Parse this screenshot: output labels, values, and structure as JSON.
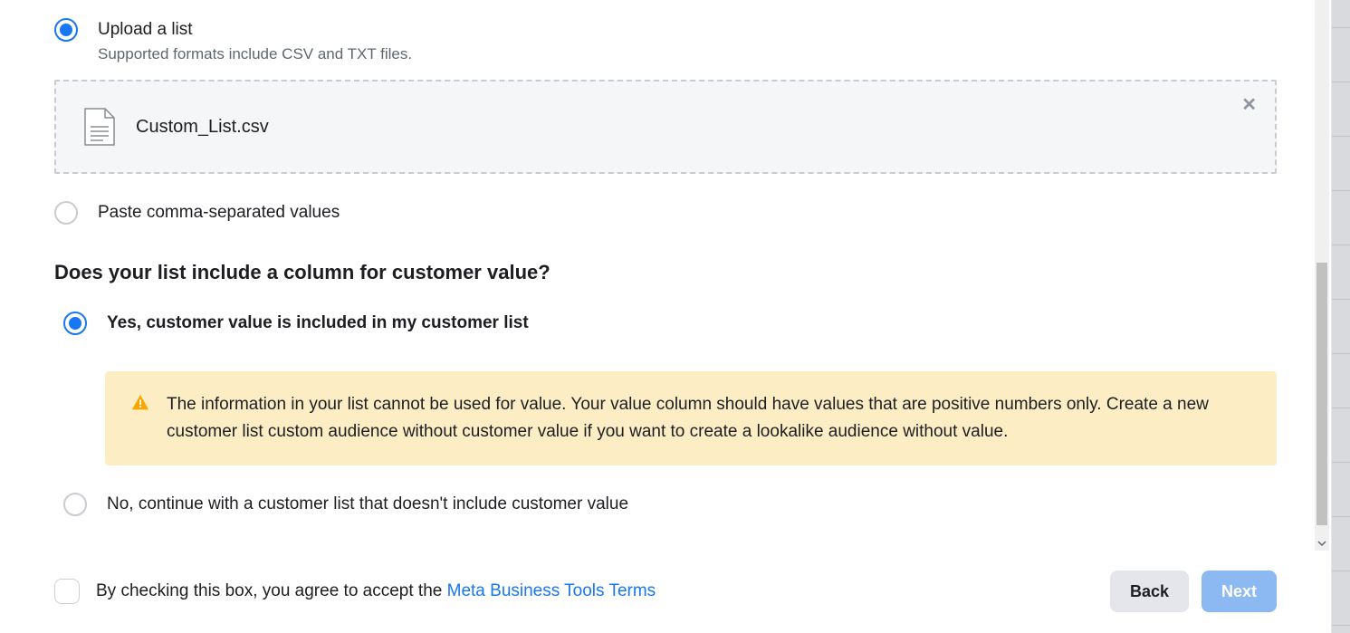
{
  "upload": {
    "option_upload_label": "Upload a list",
    "option_upload_sublabel": "Supported formats include CSV and TXT files.",
    "file_name": "Custom_List.csv",
    "option_paste_label": "Paste comma-separated values"
  },
  "customer_value": {
    "heading": "Does your list include a column for customer value?",
    "option_yes_label": "Yes, customer value is included in my customer list",
    "warning_text": "The information in your list cannot be used for value. Your value column should have values that are positive numbers only. Create a new customer list custom audience without customer value if you want to create a lookalike audience without value.",
    "option_no_label": "No, continue with a customer list that doesn't include customer value"
  },
  "footer": {
    "terms_prefix": "By checking this box, you agree to accept the ",
    "terms_link": "Meta Business Tools Terms",
    "back_label": "Back",
    "next_label": "Next"
  }
}
